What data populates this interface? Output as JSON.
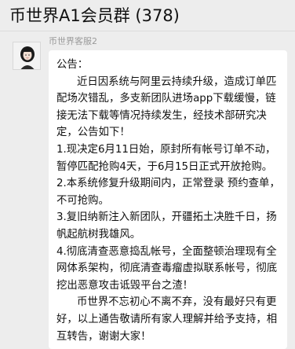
{
  "header": {
    "title": "币世界A1会员群 (378)"
  },
  "message": {
    "sender": "币世界客服2",
    "avatar": "girl-avatar",
    "paragraphs": [
      "公告：",
      "近日因系统与阿里云持续升级，造成订单匹配场次错乱，多支新团队进场app下载缓慢，链接无法下载等情况持续发生，经技术部研究决定，公告如下！",
      "1.现决定6月11日始，原封所有帐号订单不动，暂停匹配抢购4天，于6月15日正式开放抢购。",
      "2.本系统修复升级期间内，正常登录 预约查单，不可抢购。",
      "3.复旧纳新注入新团队，开疆拓土决胜千日，扬帆起航树我雄风。",
      "4.彻底清查恶意捣乱帐号，全面整顿治理现有全网体系架构，彻底清查毒瘤虚拟联系帐号，彻底挖出恶意攻击诋毁平台之渣！",
      "币世界不忘初心不离不弃，没有最好只有更好，以上通告敬请所有家人理解并给予支持，相互转告，谢谢大家！"
    ]
  }
}
